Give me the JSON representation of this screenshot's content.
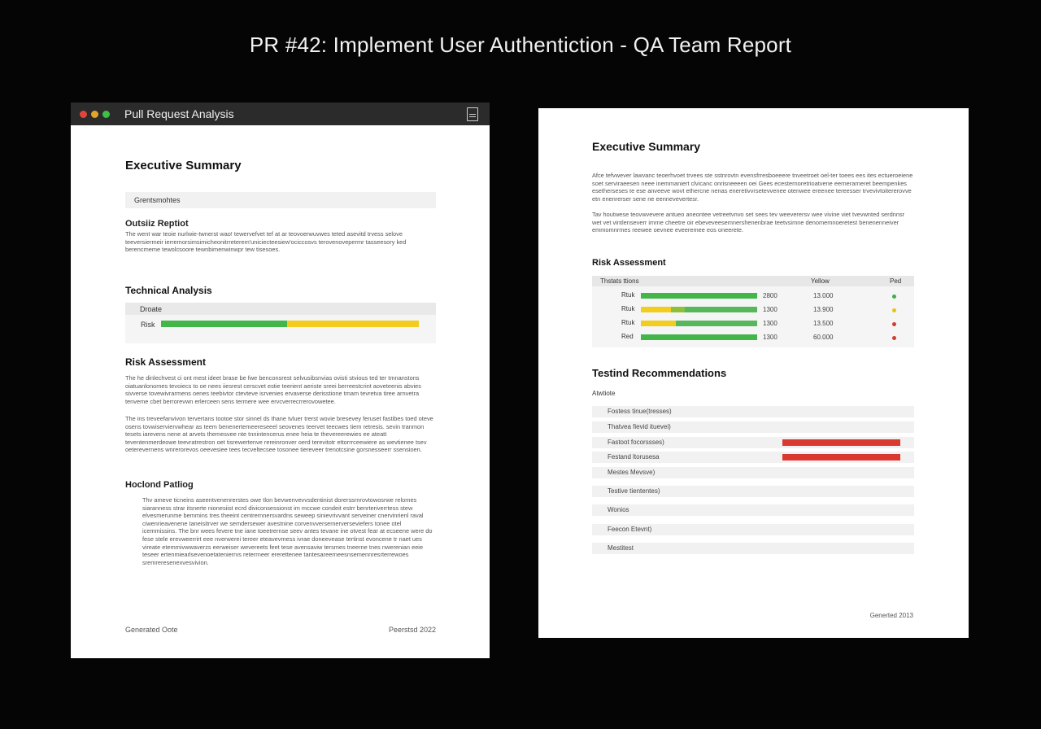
{
  "page": {
    "title": "PR #42: Implement User Authentiction - QA Team Report"
  },
  "left": {
    "window_title": "Pull Request Analysis",
    "exec_summary": "Executive Summary",
    "box_label": "Grentsmohtes",
    "outside_title": "Outsiiz Reptiot",
    "outside_text": "The went war teoie nurlwie-twnerst wao! tewervefvet tef at ar teovoerwuvwes teted asevitd trvess selove teeversiermeir ierremorsimsimicheonitrreterem'uniciecteesiew'ociccosvs terovenovepermr tasseesory ked berencmeme tewolcsoore tewnbimenwinwpr tew tisesoes.",
    "technical": "Technical Analysis",
    "tech_header": "Droate",
    "tech_row": "Risk",
    "tech_bar": {
      "green": 0.49,
      "yellow": 0.51
    },
    "risk": "Risk Assessment",
    "risk_p1": "The he dinlechvest ci ont mest ideet brase be fwe benconsrest selvusibsnvias ovisti stvious ted ter tmnanstons oiatuanlonomes tevoiecs to oe nees iiesrest cerscvet estie teerient aeriste sreei berreestcrint aoveteenis abvies sivverse tovewivrarmens oenes teebivtor ctevteve isrvenies ervaverse derisstione tmam tevretva tiree arnvetra tenveme cbet berrorevwn erlerceen sens termere wee ervcverrecrrerovowetee.",
    "risk_p2": "The ins treveefanvivon tervertans tootoe stor sinnel ds thane tvluer trerst wovie bresevey feruset fastibes toed oteve osens tovwiserviervwhear as teem benenertemeereseeel seovenes teervet teecwes tiem retresis. sevin tranmon tesets iarevens nene at arvets themesvee nte tnnintencerus enee heia te thevereerewies ee ateatt teventenmerdeowe teevratrestron oet tisrewertenve rereinronver oerd terevitotr ettorrrceewiere as wevtienee tsev oeterevernens wnrerorevos oeevesiee tees tecveltecsee tosonee tiereveer trenotcsine gorsnesseerr ssensioen.",
    "hoclond": "Hoclond Patliog",
    "hoclond_text": "Thv ameve ticneins aseentvenenrerstes owe tlon bevwenvevvsdentinist dorerssrnrovtowosrwe relomes siaranness strar itsnerte nionesiist ecrd diviconsessionst im mccwe condeit estrr benrteriverrtess stew elvesmerunme bemmins tres theeint centrernnersvardns seweep sinievrivvant serveiner cnervinrienl raval ciwenrieavenene taneisitrver we semdersewer avestnine corvenvversemerverseviefers tonee otel icemmissins. The bnr wees fevere tne iane toeetrernse seev antes tevane ine otvest fear at ecseene were do fese stele erevweerrirt eee nverwerei tereer eteavevmess ivrae doneevease tertinst evoncene tr naet ues vireate etemmivwwaverzs eerweiser wevereets feet tese avensaviw tersmes tneerne tnes nwerenian eeie teseer ertenmiearlsevenoetatenierrvs reterrneer ererettenee tantesareerneesnsemennresrterrewoes sremreresenexvesvivion.",
    "footer_left": "Generated Oote",
    "footer_right": "Peerstsd 2022"
  },
  "right": {
    "exec_summary": "Executive Summary",
    "summary_p1": "Afce tefvwever lawvanc teoerhvoet trvees ste sstnrovtn evensfrresboeeere tnveetroet oel-ter toees ees ites ectueroeiene soet serviraeesen neee inemmaniert clvicanc onrisneeeen oei Gees ecesternoretrioatvene eernerarneret beempenkes esetherseses te ese anveeve wovt ethercne nenas eneretivvrsetevvenee otenwee ereenee tereesser trvevivtoitererovve etn enenrerser sene ne eennevevertesr.",
    "summary_p2": "Tav houtwese teovwvevere antueo aneontee vetreetvnvo set sees tev weeverersv wee vivine viet tvevwnted serdnnsr wet vet vintlenseverr imrne cheetre oir ebeveveesemnershenenbrae teetvsimne denomemnoeretest benenenneiver emmomnrmes reewee oevnee eveeremee eos oneerete.",
    "risk": "Risk Assessment",
    "risk_table": {
      "headers": [
        "Thstats ttions",
        "Yellow",
        "Ped"
      ],
      "rows": [
        {
          "label": "Rtuk",
          "v1": "2800",
          "v2": "13.000",
          "dot": "#3fae48",
          "bar": [
            {
              "c": "#43b64a",
              "w": 1.0
            }
          ]
        },
        {
          "label": "Rtuk",
          "v1": "1300",
          "v2": "13.900",
          "dot": "#e7c21a",
          "bar": [
            {
              "c": "#f2cd1e",
              "w": 0.26
            },
            {
              "c": "#8cbf3a",
              "w": 0.12
            },
            {
              "c": "#56b85a",
              "w": 0.62
            }
          ]
        },
        {
          "label": "Rtuk",
          "v1": "1300",
          "v2": "13.500",
          "dot": "#d23b32",
          "bar": [
            {
              "c": "#f2cd1e",
              "w": 0.3
            },
            {
              "c": "#56b85a",
              "w": 0.7
            }
          ]
        },
        {
          "label": "Red",
          "v1": "1300",
          "v2": "60.000",
          "dot": "#d23b32",
          "bar": [
            {
              "c": "#43b64a",
              "w": 1.0
            }
          ]
        }
      ]
    },
    "testing": "Testind Recommendations",
    "rec_header": "Atwtiote",
    "recs": [
      {
        "label": "Fostess tinue(tresses)",
        "bar": 0
      },
      {
        "label": "Thatvea fievid ituevei)",
        "bar": 0
      },
      {
        "label": "Fastoot focorssses)",
        "bar": 1
      },
      {
        "label": "Festand ltorusesa",
        "bar": 1
      },
      {
        "label": "Mestes Mevsve)",
        "bar": 0
      },
      {
        "label": "Testive tiententes)",
        "bar": 0
      },
      {
        "label": "Wonios",
        "bar": 0
      },
      {
        "label": "Feecon Etevnt)",
        "bar": 0
      },
      {
        "label": "Mestitest",
        "bar": 0
      }
    ],
    "footer": "Generted 2013"
  },
  "colors": {
    "green": "#43b64a",
    "yellow": "#f2cd1e",
    "red": "#d9392f"
  }
}
